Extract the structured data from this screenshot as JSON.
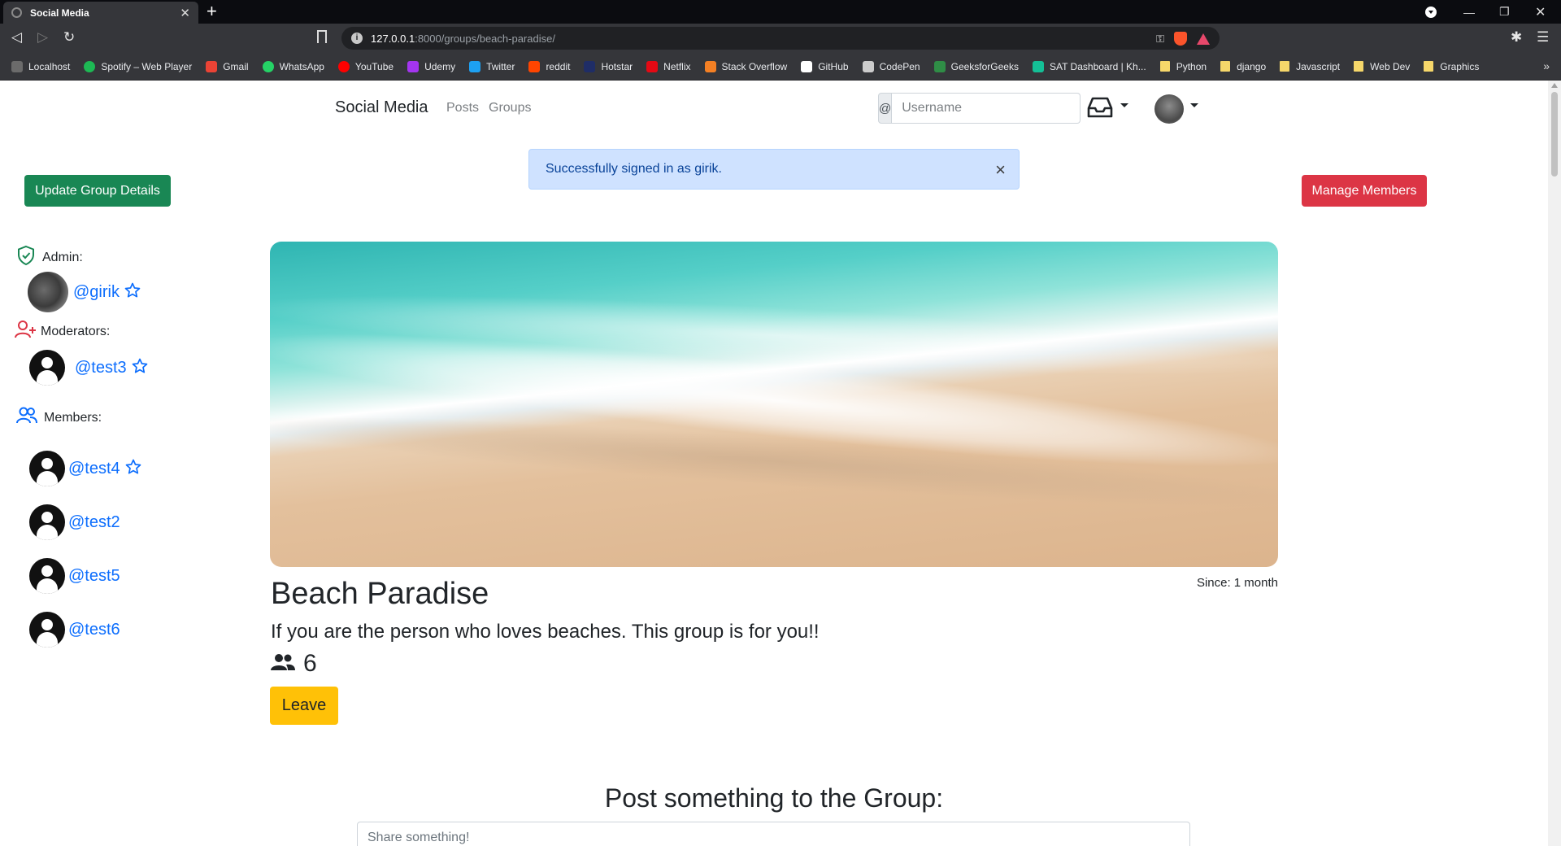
{
  "browser": {
    "tab_title": "Social Media",
    "url_host": "127.0.0.1",
    "url_path": ":8000/groups/beach-paradise/",
    "bookmarks": [
      {
        "label": "Localhost",
        "color": "#6b6b6b"
      },
      {
        "label": "Spotify – Web Player",
        "color": "#1db954"
      },
      {
        "label": "Gmail",
        "color": "#ea4335"
      },
      {
        "label": "WhatsApp",
        "color": "#25d366"
      },
      {
        "label": "YouTube",
        "color": "#ff0000"
      },
      {
        "label": "Udemy",
        "color": "#a435f0"
      },
      {
        "label": "Twitter",
        "color": "#1da1f2"
      },
      {
        "label": "reddit",
        "color": "#ff4500"
      },
      {
        "label": "Hotstar",
        "color": "#1f2d66"
      },
      {
        "label": "Netflix",
        "color": "#e50914"
      },
      {
        "label": "Stack Overflow",
        "color": "#f48024"
      },
      {
        "label": "GitHub",
        "color": "#ffffff"
      },
      {
        "label": "CodePen",
        "color": "#cccccc"
      },
      {
        "label": "GeeksforGeeks",
        "color": "#2f8d46"
      },
      {
        "label": "SAT Dashboard | Kh...",
        "color": "#14bf96"
      }
    ],
    "folders": [
      "Python",
      "django",
      "Javascript",
      "Web Dev",
      "Graphics"
    ]
  },
  "nav": {
    "brand": "Social Media",
    "links": [
      "Posts",
      "Groups"
    ],
    "search_prefix": "@",
    "search_placeholder": "Username"
  },
  "alert": {
    "message": "Successfully signed in as girik.",
    "close": "×"
  },
  "actions": {
    "update": "Update Group Details",
    "manage": "Manage Members"
  },
  "sidebar": {
    "admin_label": "Admin:",
    "admin": "@girik",
    "moderators_label": "Moderators:",
    "moderators": [
      "@test3"
    ],
    "members_label": "Members:",
    "members": [
      {
        "name": "@test4",
        "starred": true
      },
      {
        "name": "@test2",
        "starred": false
      },
      {
        "name": "@test5",
        "starred": false
      },
      {
        "name": "@test6",
        "starred": false
      }
    ]
  },
  "group": {
    "title": "Beach Paradise",
    "description": "If you are the person who loves beaches. This group is for you!!",
    "member_count": "6",
    "since": "Since: 1 month",
    "leave": "Leave"
  },
  "post": {
    "heading": "Post something to the Group:",
    "placeholder": "Share something!"
  },
  "colors": {
    "primary": "#0d6efd",
    "success": "#198754",
    "danger": "#dc3545",
    "warning": "#ffc107",
    "alert_bg": "#cfe2ff"
  }
}
